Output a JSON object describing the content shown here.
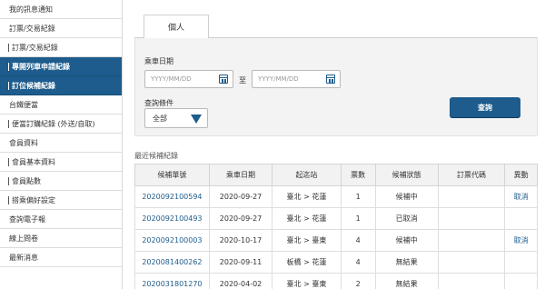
{
  "sidebar": {
    "items": [
      {
        "label": "我的訊息通知",
        "type": "group",
        "active": false
      },
      {
        "label": "訂票/交易紀錄",
        "type": "group",
        "active": false
      },
      {
        "label": "訂票/交易紀錄",
        "type": "sub",
        "active": false
      },
      {
        "label": "專開列車申請紀錄",
        "type": "sub",
        "active": true
      },
      {
        "label": "訂位候補紀錄",
        "type": "sub",
        "active": true
      },
      {
        "label": "台鐵便當",
        "type": "group",
        "active": false
      },
      {
        "label": "便當訂購紀錄 (外送/自取)",
        "type": "sub",
        "active": false
      },
      {
        "label": "會員資料",
        "type": "group",
        "active": false
      },
      {
        "label": "會員基本資料",
        "type": "sub",
        "active": false
      },
      {
        "label": "會員點數",
        "type": "sub",
        "active": false
      },
      {
        "label": "搭乘偏好設定",
        "type": "sub",
        "active": false
      },
      {
        "label": "查詢電子報",
        "type": "group",
        "active": false
      },
      {
        "label": "線上問卷",
        "type": "group",
        "active": false
      },
      {
        "label": "最新消息",
        "type": "group",
        "active": false
      }
    ]
  },
  "tab": {
    "label": "個人"
  },
  "search": {
    "date_label": "乘車日期",
    "date_from_placeholder": "YYYY/MM/DD",
    "date_to_placeholder": "YYYY/MM/DD",
    "to_label": "至",
    "condition_label": "查詢條件",
    "condition_value": "全部",
    "query_button": "查詢"
  },
  "records": {
    "title": "最近候補紀錄",
    "columns": [
      "候補單號",
      "乘車日期",
      "起迄站",
      "票數",
      "候補狀態",
      "訂票代碼",
      "異動"
    ],
    "rows": [
      {
        "id": "2020092100594",
        "date": "2020-09-27",
        "route": "臺北 > 花蓮",
        "count": "1",
        "status": "候補中",
        "code": "",
        "action": "取消"
      },
      {
        "id": "2020092100493",
        "date": "2020-09-27",
        "route": "臺北 > 花蓮",
        "count": "1",
        "status": "已取消",
        "code": "",
        "action": ""
      },
      {
        "id": "2020092100003",
        "date": "2020-10-17",
        "route": "臺北 > 臺東",
        "count": "4",
        "status": "候補中",
        "code": "",
        "action": "取消"
      },
      {
        "id": "2020081400262",
        "date": "2020-09-11",
        "route": "板橋 > 花蓮",
        "count": "4",
        "status": "無結果",
        "code": "",
        "action": ""
      },
      {
        "id": "2020031801270",
        "date": "2020-04-02",
        "route": "臺北 > 臺東",
        "count": "2",
        "status": "無結果",
        "code": "",
        "action": ""
      }
    ]
  },
  "colors": {
    "accent": "#1d5c8c",
    "panel_bg": "#f3f3f3"
  },
  "icons": {
    "calendar": "calendar-icon",
    "dropdown": "triangle-down-icon"
  }
}
